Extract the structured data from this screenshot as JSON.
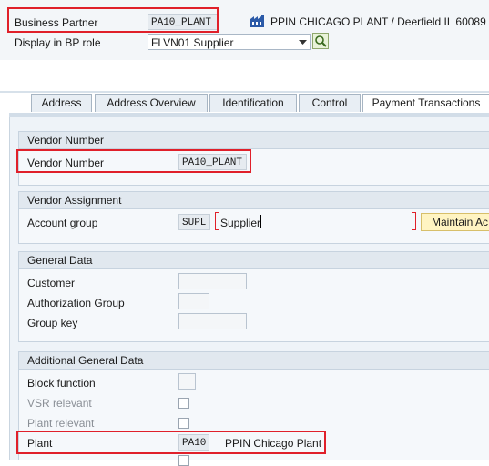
{
  "header": {
    "bp_label": "Business Partner",
    "bp_value": "PA10_PLANT",
    "bp_description": "PPIN CHICAGO PLANT / Deerfield IL 60089",
    "role_label": "Display in BP role",
    "role_value": "FLVN01 Supplier"
  },
  "tabs": [
    {
      "label": "Address"
    },
    {
      "label": "Address Overview"
    },
    {
      "label": "Identification"
    },
    {
      "label": "Control"
    },
    {
      "label": "Payment Transactions"
    }
  ],
  "sections": {
    "vendor_number": {
      "title": "Vendor Number",
      "label": "Vendor Number",
      "value": "PA10_PLANT"
    },
    "vendor_assignment": {
      "title": "Vendor Assignment",
      "account_group_label": "Account group",
      "account_group_code": "SUPL",
      "account_group_text": "Supplier",
      "maintain_button": "Maintain Ac"
    },
    "general_data": {
      "title": "General Data",
      "customer_label": "Customer",
      "customer_value": "",
      "authorization_group_label": "Authorization Group",
      "authorization_group_value": "",
      "group_key_label": "Group key",
      "group_key_value": ""
    },
    "additional_general_data": {
      "title": "Additional General Data",
      "block_function_label": "Block function",
      "vsr_relevant_label": "VSR relevant",
      "plant_relevant_label": "Plant relevant",
      "plant_label": "Plant",
      "plant_code": "PA10",
      "plant_name": "PPIN Chicago Plant"
    }
  },
  "colors": {
    "highlight": "#e0202a",
    "maintain_button_bg": "#fff4c2",
    "section_header_bg": "#e1e8ef"
  }
}
